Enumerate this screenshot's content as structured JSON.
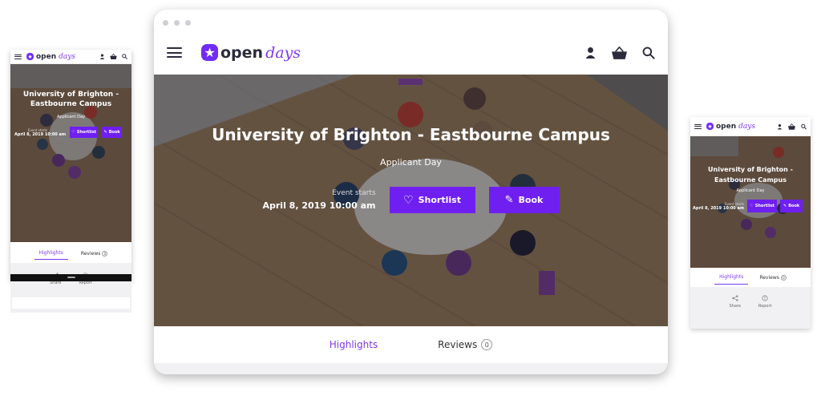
{
  "brand": {
    "logo_open": "open",
    "logo_days": "days",
    "accent": "#6f1ff0"
  },
  "event": {
    "title": "University of Brighton - Eastbourne Campus",
    "title_line1": "University of Brighton -",
    "title_line2": "Eastbourne Campus",
    "subtitle": "Applicant Day",
    "starts_label": "Event starts",
    "starts_value": "April 8, 2019 10:00 am"
  },
  "buttons": {
    "shortlist": "Shortlist",
    "book": "Book"
  },
  "tabs": {
    "highlights": "Highlights",
    "reviews": "Reviews",
    "reviews_count": "0"
  },
  "actions": {
    "share": "Share",
    "report": "Report"
  },
  "icons": [
    "menu-icon",
    "user-icon",
    "basket-icon",
    "search-icon",
    "heart-icon",
    "ticket-icon",
    "share-icon",
    "report-icon"
  ]
}
